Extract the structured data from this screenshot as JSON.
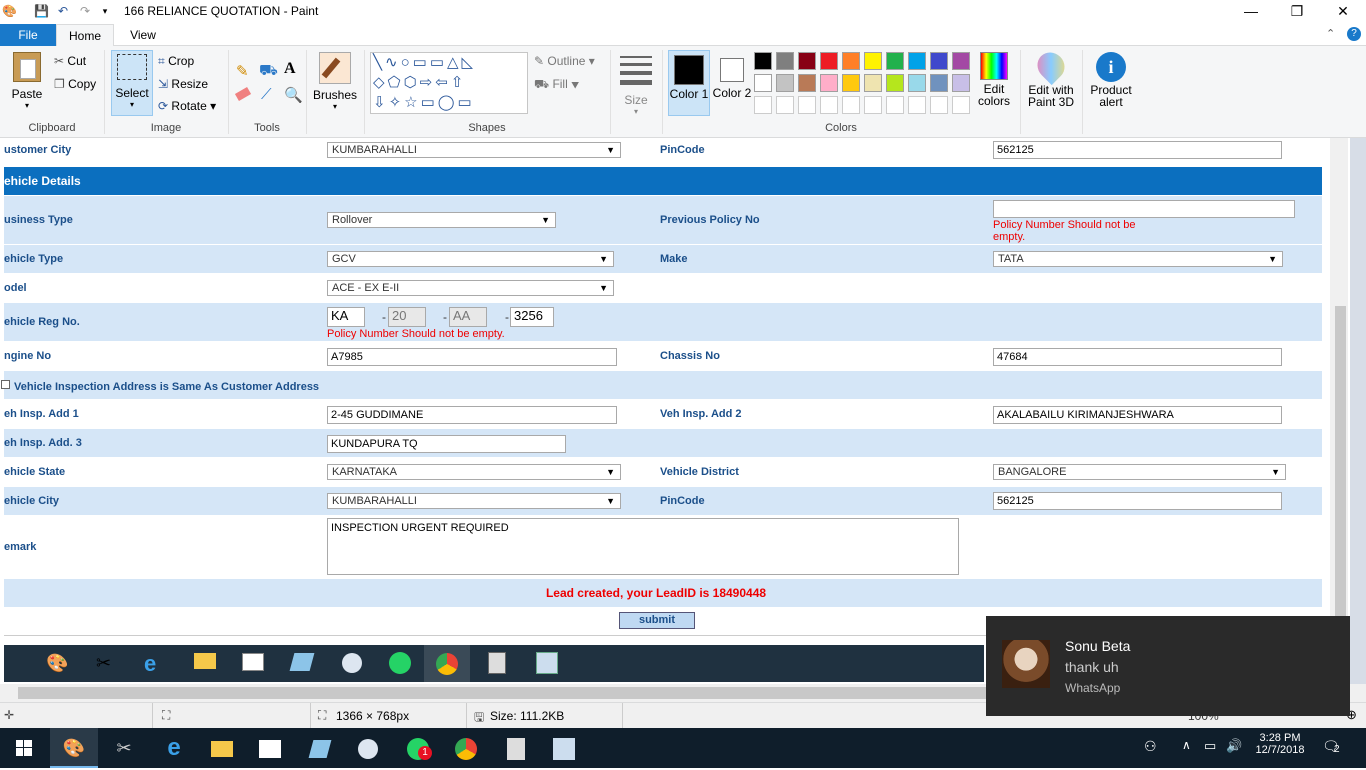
{
  "window": {
    "title": "166 RELIANCE QUOTATION - Paint",
    "minimize": "—",
    "restore": "❐",
    "close": "✕"
  },
  "tabs": {
    "file": "File",
    "home": "Home",
    "view": "View"
  },
  "ribbon": {
    "clipboard": {
      "paste": "Paste",
      "cut": "Cut",
      "copy": "Copy",
      "label": "Clipboard"
    },
    "image": {
      "select": "Select",
      "crop": "Crop",
      "resize": "Resize",
      "rotate": "Rotate",
      "label": "Image"
    },
    "tools": {
      "label": "Tools"
    },
    "brushes": "Brushes",
    "shapes": {
      "outline": "Outline",
      "fill": "Fill",
      "label": "Shapes"
    },
    "size": "Size",
    "colors": {
      "color1": "Color 1",
      "color2": "Color 2",
      "edit": "Edit colors",
      "label": "Colors"
    },
    "paint3d": "Edit with Paint 3D",
    "product_alert": "Product alert"
  },
  "palette": [
    "#000000",
    "#7f7f7f",
    "#880015",
    "#ed1c24",
    "#ff7f27",
    "#fff200",
    "#22b14c",
    "#00a2e8",
    "#3f48cc",
    "#a349a4",
    "#ffffff",
    "#c3c3c3",
    "#b97a57",
    "#ffaec9",
    "#ffc90e",
    "#efe4b0",
    "#b5e61d",
    "#99d9ea",
    "#7092be",
    "#c8bfe7"
  ],
  "form": {
    "customer_city_label": "ustomer City",
    "customer_city": "KUMBARAHALLI",
    "pincode_label": "PinCode",
    "pincode": "562125",
    "section_title": "ehicle Details",
    "business_type_label": "usiness Type",
    "business_type": "Rollover",
    "prev_policy_label": "Previous Policy No",
    "prev_policy_error": "Policy Number Should not be empty.",
    "vehicle_type_label": "ehicle Type",
    "vehicle_type": "GCV",
    "make_label": "Make",
    "make": "TATA",
    "model_label": "odel",
    "model": "ACE - EX E-II",
    "reg_label": "ehicle Reg No.",
    "reg1": "KA",
    "reg2": "20",
    "reg3": "AA",
    "reg4": "3256",
    "dash": "-",
    "reg_error": "Policy Number Should not be empty.",
    "engine_label": "ngine No",
    "engine": "A7985",
    "chassis_label": "Chassis No",
    "chassis": "47684",
    "same_address_label": "Vehicle Inspection Address is Same As Customer Address",
    "add1_label": "eh Insp. Add 1",
    "add1": "2-45 GUDDIMANE",
    "add2_label": "Veh Insp. Add 2",
    "add2": "AKALABAILU KIRIMANJESHWARA",
    "add3_label": "eh Insp. Add. 3",
    "add3": "KUNDAPURA TQ",
    "state_label": "ehicle State",
    "state": "KARNATAKA",
    "district_label": "Vehicle District",
    "district": "BANGALORE",
    "vcity_label": "ehicle City",
    "vcity": "KUMBARAHALLI",
    "vpincode_label": "PinCode",
    "vpincode": "562125",
    "remark_label": "emark",
    "remark": "INSPECTION URGENT REQUIRED",
    "lead_message": "Lead created, your LeadID is 18490448",
    "submit": "submit"
  },
  "status": {
    "dimensions": "1366 × 768px",
    "size": "Size: 111.2KB",
    "zoom": "100%"
  },
  "taskbar": {
    "time": "3:28 PM",
    "date": "12/7/2018",
    "whatsapp_badge": "1",
    "notif_count": "2"
  },
  "toast": {
    "sender": "Sonu Beta",
    "message": "thank uh",
    "app": "WhatsApp"
  }
}
